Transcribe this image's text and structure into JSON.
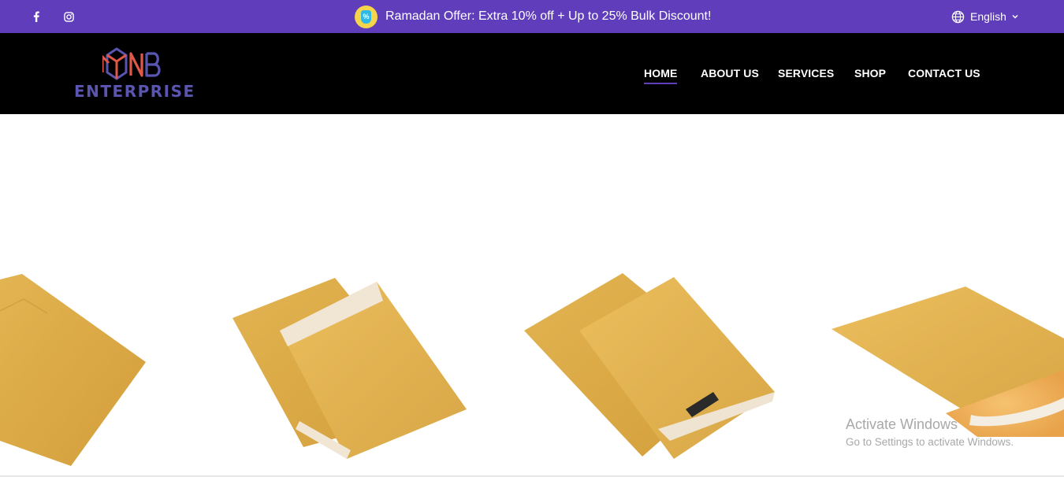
{
  "topbar": {
    "social": [
      {
        "icon": "facebook-icon"
      },
      {
        "icon": "instagram-icon"
      }
    ],
    "offer_text": "Ramadan Offer: Extra 10% off + Up to 25% Bulk Discount!",
    "offer_badge_symbol": "%",
    "language": "English",
    "background": "#5f3dbb"
  },
  "header": {
    "logo_letters": "MNB",
    "logo_word": "ENTERPRISE",
    "nav": [
      {
        "label": "HOME",
        "active": true
      },
      {
        "label": "ABOUT US",
        "active": false
      },
      {
        "label": "SERVICES",
        "active": false
      },
      {
        "label": "SHOP",
        "active": false
      },
      {
        "label": "CONTACT US",
        "active": false
      }
    ]
  },
  "watermark": {
    "title": "Activate Windows",
    "subtitle": "Go to Settings to activate Windows."
  }
}
